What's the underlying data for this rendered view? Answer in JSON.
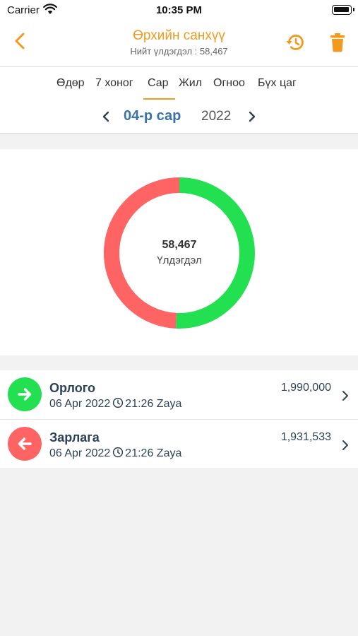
{
  "status_bar": {
    "carrier": "Carrier",
    "time": "10:35 PM"
  },
  "header": {
    "title": "Өрхийн санхүү",
    "subtitle": "Нийт үлдэгдэл : 58,467",
    "accent_color": "#f29a1e"
  },
  "period_tabs": [
    {
      "label": "Өдөр",
      "selected": false
    },
    {
      "label": "7 хоног",
      "selected": false
    },
    {
      "label": "Сар",
      "selected": true
    },
    {
      "label": "Жил",
      "selected": false
    },
    {
      "label": "Огноо",
      "selected": false
    },
    {
      "label": "Бүх цаг",
      "selected": false
    }
  ],
  "date_nav": {
    "month": "04-р сар",
    "year": "2022"
  },
  "summary": {
    "balance": "58,467",
    "balance_label": "Үлдэгдэл"
  },
  "chart_data": {
    "type": "pie",
    "title": "",
    "categories": [
      "Орлого",
      "Зарлага"
    ],
    "values": [
      1990000,
      1931533
    ],
    "colors": [
      "#22e04f",
      "#ff6464"
    ]
  },
  "transactions": [
    {
      "title": "Орлого",
      "date": "06 Apr 2022",
      "time": "21:26",
      "user": "Zaya",
      "amount": "1,990,000",
      "icon": "arrow-right-icon",
      "color": "#22e04f"
    },
    {
      "title": "Зарлага",
      "date": "06 Apr 2022",
      "time": "21:26",
      "user": "Zaya",
      "amount": "1,931,533",
      "icon": "arrow-left-icon",
      "color": "#ff6464"
    }
  ]
}
